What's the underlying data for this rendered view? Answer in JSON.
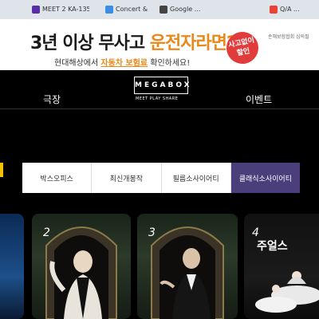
{
  "browser": {
    "tabs": [
      {
        "label": "MEET 2 KA-135 ..."
      },
      {
        "label": "Concert & ..."
      },
      {
        "label": "Google ..."
      },
      {
        "label": "Q/A ..."
      }
    ]
  },
  "banner": {
    "headline_part1": "3년 이상 무사고 ",
    "headline_highlight": "운전자라면?",
    "sub_prefix": "현대해상에서 ",
    "sub_highlight": "자동차 보험료",
    "sub_suffix": " 확인하세요!",
    "stamp": "사고없이 할인",
    "fine_print": "손해보험협회 심의필"
  },
  "nav": {
    "left_item": "극장",
    "right_item": "이벤트",
    "logo": "MEGABOX",
    "logo_tagline": "MEET PLAY SHARE"
  },
  "categories": [
    {
      "label": "박스오피스",
      "active": false
    },
    {
      "label": "최신개봉작",
      "active": false
    },
    {
      "label": "필름소사이어티",
      "active": false
    },
    {
      "label": "클래식소사이어티",
      "active": true
    }
  ],
  "posters": [
    {
      "rank": "2"
    },
    {
      "rank": "3"
    },
    {
      "rank": "4",
      "title": "주얼스"
    }
  ]
}
